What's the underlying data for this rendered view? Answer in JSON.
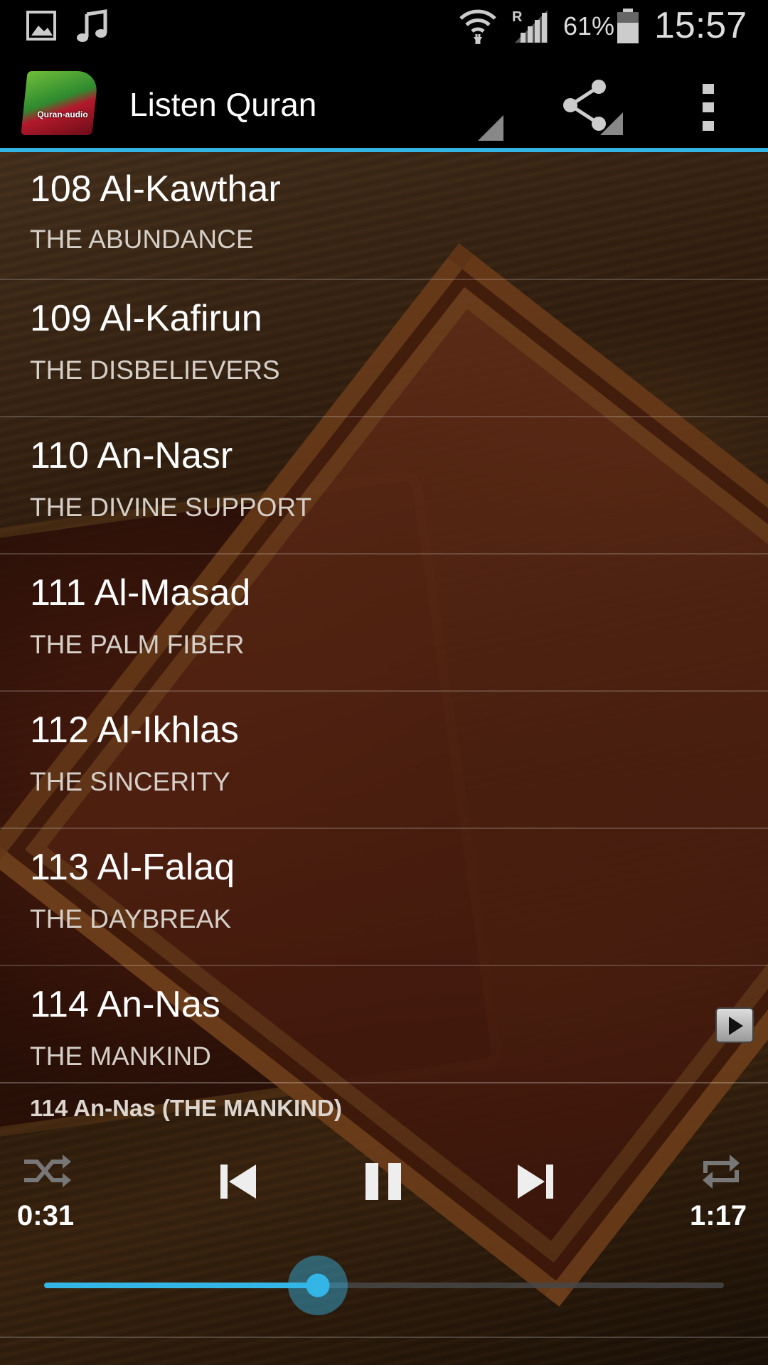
{
  "status_bar": {
    "battery_percent": "61%",
    "time": "15:57",
    "icons": [
      "gallery-icon",
      "music-note-icon",
      "wifi-icon",
      "roaming-signal-icon",
      "battery-icon"
    ]
  },
  "action_bar": {
    "logo_text": "Quran-audio",
    "title": "Listen Quran",
    "icons": [
      "share-icon",
      "overflow-menu-icon"
    ]
  },
  "surahs": [
    {
      "name": "108 Al-Kawthar",
      "subtitle": "THE ABUNDANCE"
    },
    {
      "name": "109 Al-Kafirun",
      "subtitle": "THE DISBELIEVERS"
    },
    {
      "name": "110 An-Nasr",
      "subtitle": "THE DIVINE SUPPORT"
    },
    {
      "name": "111 Al-Masad",
      "subtitle": "THE PALM FIBER"
    },
    {
      "name": "112 Al-Ikhlas",
      "subtitle": "THE SINCERITY"
    },
    {
      "name": "113 Al-Falaq",
      "subtitle": "THE DAYBREAK"
    },
    {
      "name": "114 An-Nas",
      "subtitle": "THE MANKIND"
    }
  ],
  "player": {
    "now_playing": "114 An-Nas (THE MANKIND)",
    "elapsed": "0:31",
    "duration": "1:17",
    "progress_fraction": 0.403,
    "accent_color": "#33b5e5",
    "controls": [
      "shuffle-icon",
      "previous-icon",
      "pause-icon",
      "next-icon",
      "repeat-icon"
    ]
  }
}
